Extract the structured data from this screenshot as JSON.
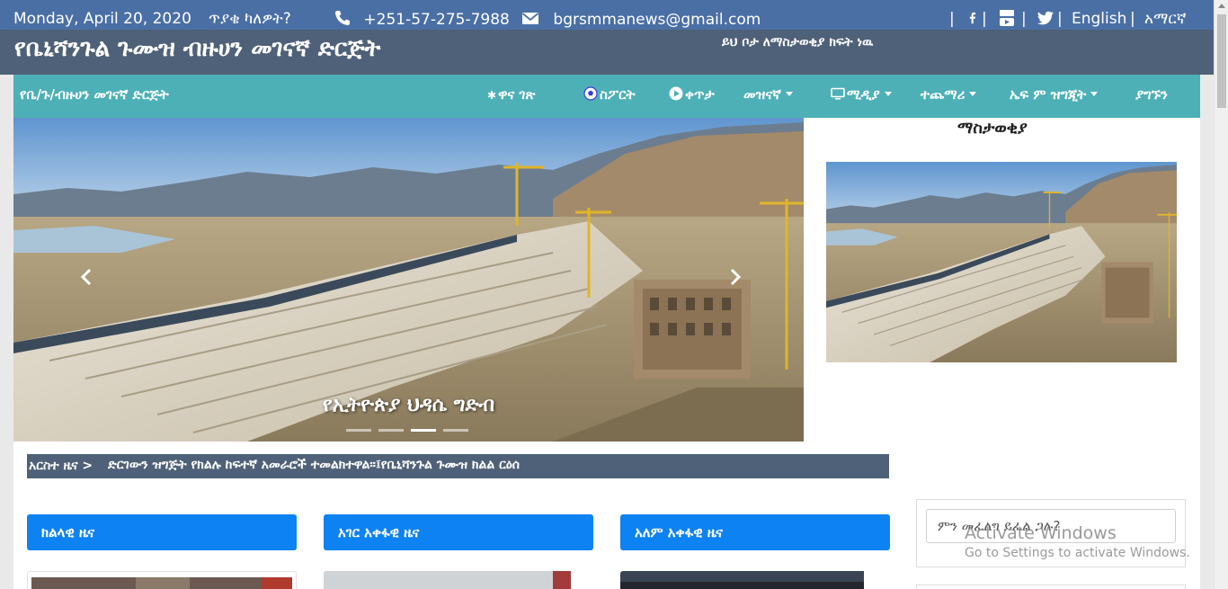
{
  "topbar": {
    "date": "Monday, April 20, 2020",
    "question": "ጥያቄ ካለዎት?",
    "phone": "+251-57-275-7988",
    "email": "bgrsmmanews@gmail.com",
    "lang_english": "English",
    "lang_amharic": "አማርኛ",
    "separator": "|"
  },
  "header": {
    "site_title": "የቤኒሻንጉል ጉሙዝ ብዙሀን መገናኛ ድርጅት",
    "ad_note": "ይህ ቦታ ለማስታወቂያ ክፍት ነዉ"
  },
  "nav": {
    "brand": "የቤ/ጉ/ብዙሀን መገናኛ ድርጅት",
    "items": [
      {
        "label": "ዋና ገጽ"
      },
      {
        "label": "ስፖርት"
      },
      {
        "label": "ቀጥታ"
      },
      {
        "label": "መዝናኛ"
      },
      {
        "label": "ሚዲያ"
      },
      {
        "label": "ተጨማሪ"
      },
      {
        "label": "ኤፍ ም ዝግጂት"
      },
      {
        "label": "ያግኙን"
      }
    ]
  },
  "carousel": {
    "caption": "የኢትዮጵያ ህዳሴ ግድብ",
    "slide_count": 4,
    "active_index": 2
  },
  "sidebar": {
    "heading": "ማስታወቂያ",
    "search_placeholder": "ምን መፈለግ ይፈል ጋሉ?"
  },
  "ticker": {
    "label": "አርስተ ዜና >",
    "text": "ድርገውን ዝግጅት የክልሉ ከፍተኛ አመራሮች ተመልክተዋል፡፡፤የቤኒሻንጉል ጉሙዝ ክልል ርዕሰ"
  },
  "sections": [
    {
      "title": "ክልላዊ ዜና"
    },
    {
      "title": "አገር አቀፋዊ ዜና"
    },
    {
      "title": "አለም አቀፋዊ ዜና"
    }
  ],
  "watermark": {
    "title": "Activate Windows",
    "subtitle": "Go to Settings to activate Windows."
  },
  "colors": {
    "topbar": "#4a6fa5",
    "titleband": "#4f6178",
    "navbar": "#4db0b7",
    "section_header": "#0d82f2"
  }
}
